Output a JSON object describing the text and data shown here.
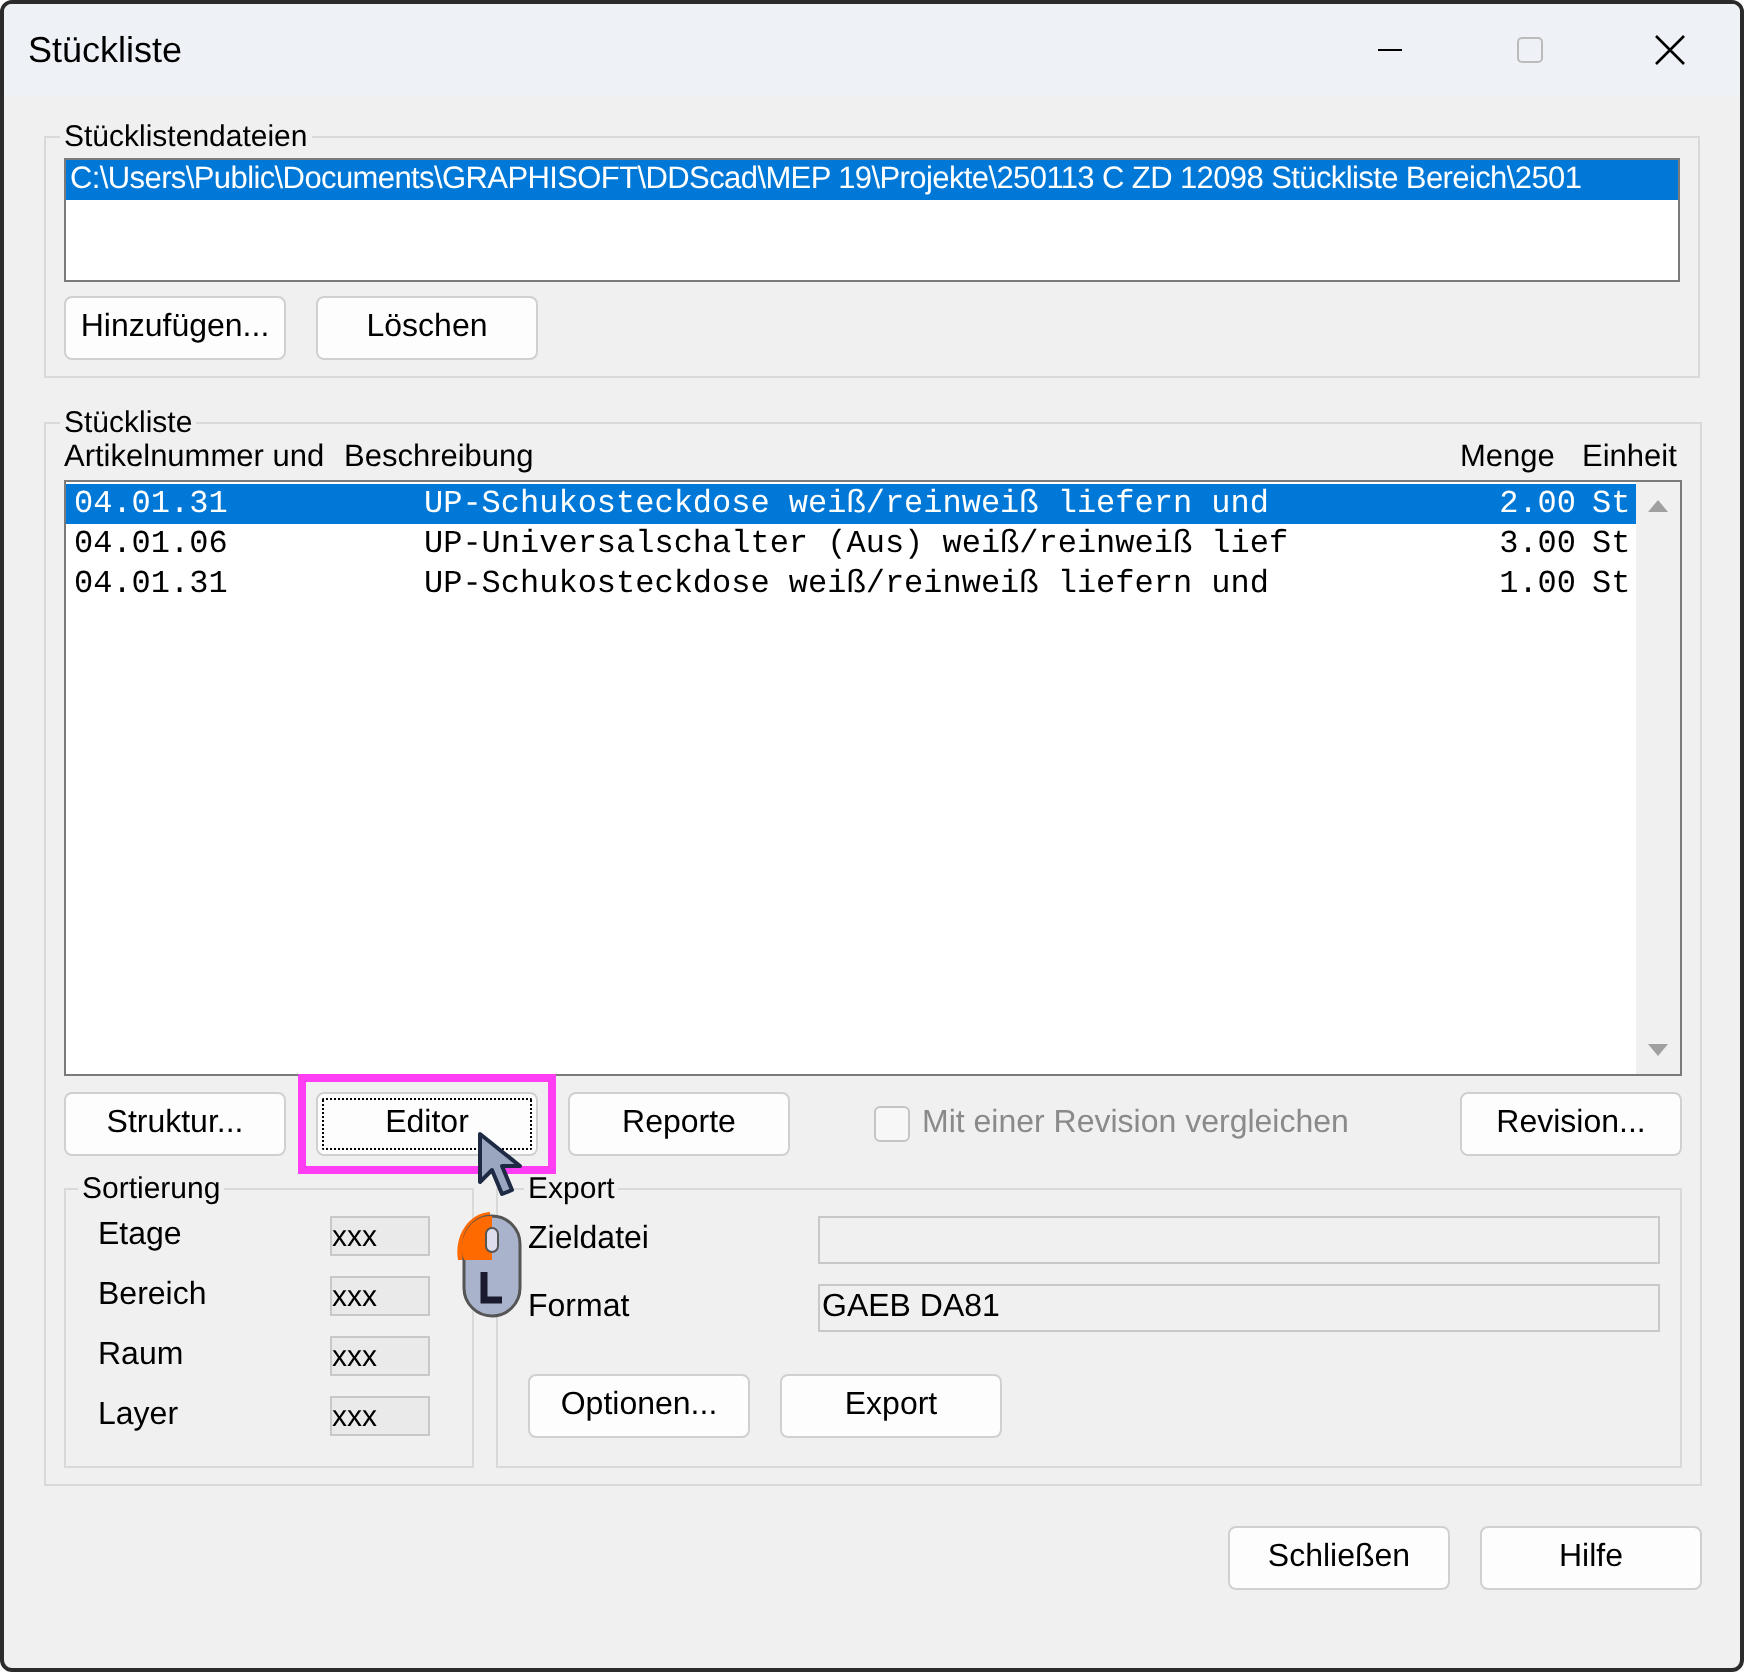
{
  "window": {
    "title": "Stückliste"
  },
  "files_group": {
    "legend": "Stücklistendateien",
    "files": [
      {
        "path": "C:\\Users\\Public\\Documents\\GRAPHISOFT\\DDScad\\MEP 19\\Projekte\\250113 C ZD 12098 Stückliste Bereich\\2501",
        "selected": true
      }
    ],
    "buttons": [
      "Hinzufügen...",
      "Löschen"
    ]
  },
  "list_group": {
    "legend": "Stückliste",
    "columns": [
      "Artikelnummer und",
      "Beschreibung",
      "Menge",
      "Einheit"
    ],
    "rows": [
      {
        "article": "04.01.31",
        "description": "UP-Schukosteckdose weiß/reinweiß liefern und",
        "quantity": "2.00",
        "unit": "St",
        "selected": true
      },
      {
        "article": "04.01.06",
        "description": "UP-Universalschalter (Aus) weiß/reinweiß lief",
        "quantity": "3.00",
        "unit": "St",
        "selected": false
      },
      {
        "article": "04.01.31",
        "description": "UP-Schukosteckdose weiß/reinweiß liefern und",
        "quantity": "1.00",
        "unit": "St",
        "selected": false
      }
    ],
    "buttons": [
      {
        "label": "Struktur...",
        "highlighted": false
      },
      {
        "label": "Editor",
        "highlighted": true
      },
      {
        "label": "Reporte",
        "highlighted": false
      }
    ],
    "compare_checkbox": {
      "label": "Mit einer Revision vergleichen",
      "checked": false,
      "disabled": true
    },
    "revision_button": "Revision..."
  },
  "sorting": {
    "legend": "Sortierung",
    "fields": [
      {
        "label": "Etage",
        "value": "xxx"
      },
      {
        "label": "Bereich",
        "value": "xxx"
      },
      {
        "label": "Raum",
        "value": "xxx"
      },
      {
        "label": "Layer",
        "value": "xxx"
      }
    ]
  },
  "export": {
    "legend": "Export",
    "fields": [
      {
        "label": "Zieldatei"
      },
      {
        "label": "Format",
        "value": "GAEB DA81"
      }
    ],
    "buttons": [
      "Optionen...",
      "Export"
    ]
  },
  "footer_buttons": [
    "Schließen",
    "Hilfe"
  ]
}
